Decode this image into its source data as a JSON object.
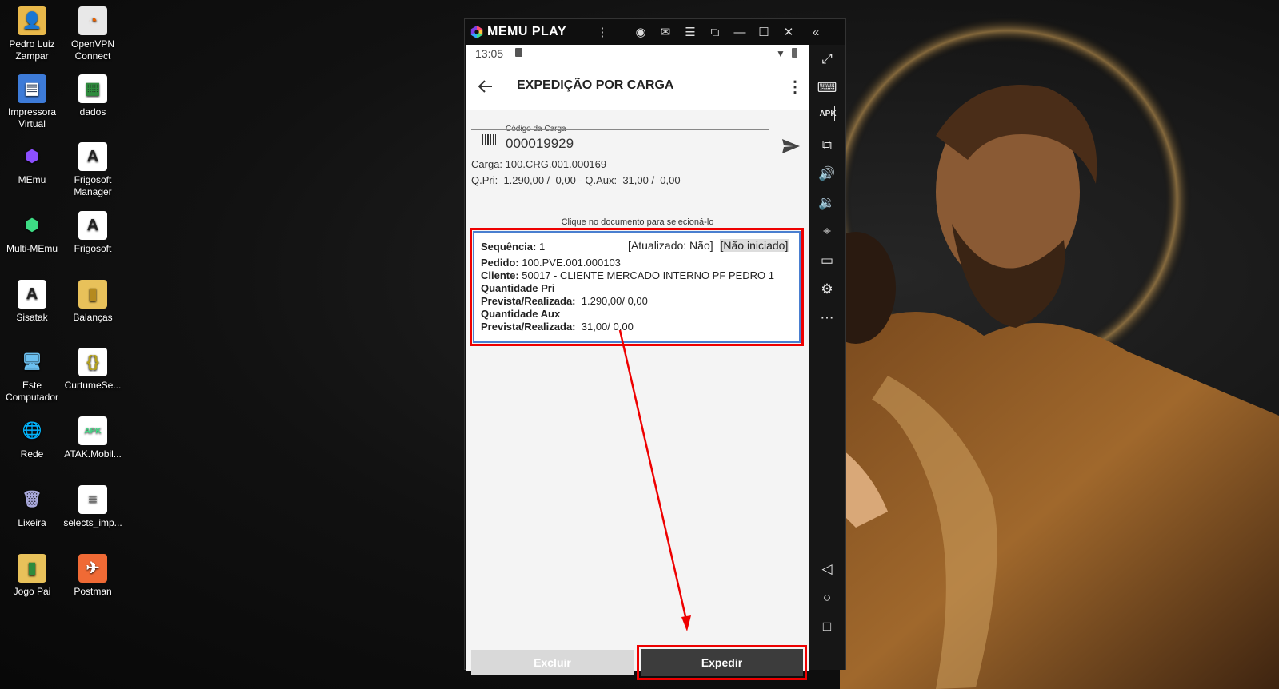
{
  "desktop": {
    "icons": [
      {
        "label": "Pedro Luiz Zampar"
      },
      {
        "label": "OpenVPN Connect"
      },
      {
        "label": "Impressora Virtual"
      },
      {
        "label": "dados"
      },
      {
        "label": "MEmu"
      },
      {
        "label": "Frigosoft Manager"
      },
      {
        "label": "Multi-MEmu"
      },
      {
        "label": "Frigosoft"
      },
      {
        "label": "Sisatak"
      },
      {
        "label": "Balanças"
      },
      {
        "label": "Este Computador"
      },
      {
        "label": "CurtumeSe..."
      },
      {
        "label": "Rede"
      },
      {
        "label": "ATAK.Mobil..."
      },
      {
        "label": "Lixeira"
      },
      {
        "label": "selects_imp..."
      },
      {
        "label": "Jogo Pai"
      },
      {
        "label": "Postman"
      }
    ]
  },
  "emulator": {
    "brand": "MEMU PLAY"
  },
  "status_bar": {
    "time": "13:05"
  },
  "app": {
    "title": "EXPEDIÇÃO POR CARGA",
    "code_label": "Código da Carga",
    "code_value": "000019929",
    "carga_line": "Carga: 100.CRG.001.000169",
    "qty_line": "Q.Pri:  1.290,00 /  0,00 - Q.Aux:  31,00 /  0,00",
    "hint": "Clique no documento para selecioná-lo",
    "card": {
      "seq_label": "Sequência:",
      "seq_value": "1",
      "updated": "[Atualizado: Não]",
      "status": "[Não iniciado]",
      "pedido_label": "Pedido:",
      "pedido_value": "100.PVE.001.000103",
      "cliente_label": "Cliente:",
      "cliente_value": "50017 - CLIENTE MERCADO INTERNO PF PEDRO 1",
      "qpri_label": "Quantidade Pri",
      "prev_label": "Prevista/Realizada:",
      "qpri_value": "1.290,00/ 0,00",
      "qaux_label": "Quantidade Aux",
      "qaux_value": "31,00/ 0,00"
    },
    "excluir_label": "Excluir",
    "expedir_label": "Expedir"
  },
  "colors": {
    "highlight": "#e00000",
    "card_border": "#4a7fd0",
    "expedir_bg": "#3c3c3c"
  }
}
